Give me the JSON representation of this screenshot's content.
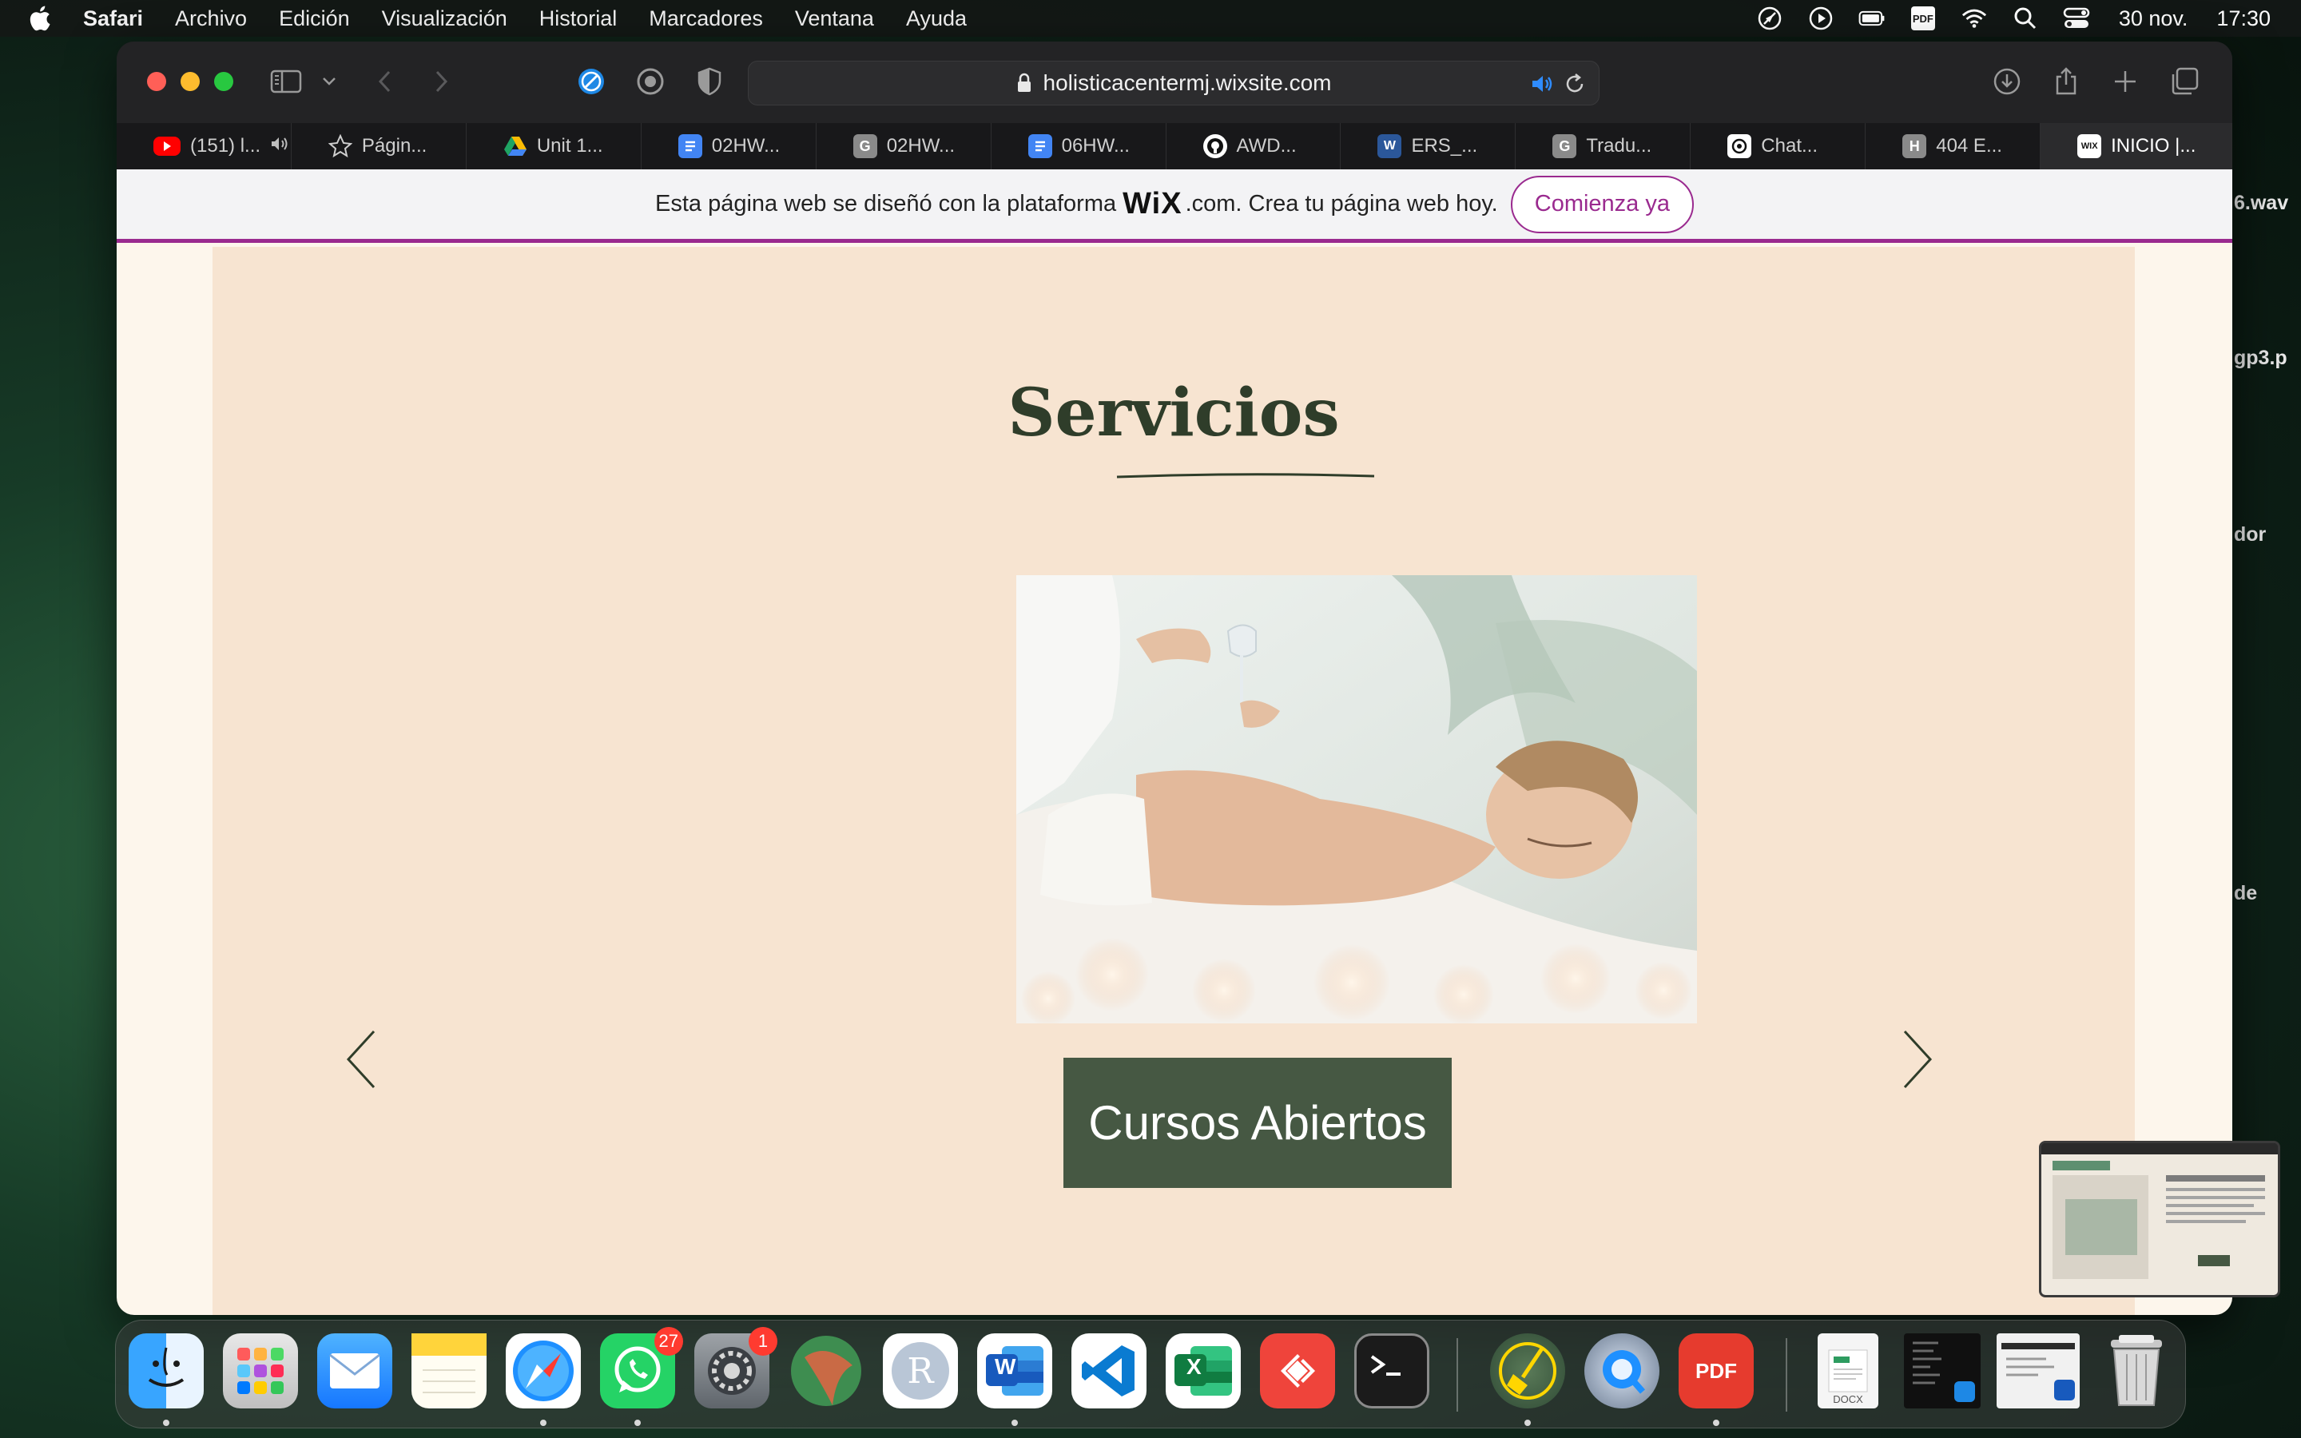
{
  "menubar": {
    "app": "Safari",
    "items": [
      "Archivo",
      "Edición",
      "Visualización",
      "Historial",
      "Marcadores",
      "Ventana",
      "Ayuda"
    ],
    "status_icons": [
      "location-icon",
      "play-icon",
      "battery-icon",
      "pdf-icon",
      "wifi-icon",
      "search-icon",
      "control-center-icon"
    ],
    "pdf_label": "PDF",
    "date": "30 nov.",
    "time": "17:30"
  },
  "browser": {
    "url": "holisticacentermj.wixsite.com",
    "tabs": [
      {
        "label": "(151) l...",
        "icon": "youtube-icon",
        "color": "#ff0000"
      },
      {
        "label": "Págin...",
        "icon": "star-icon",
        "color": "#cfcfcf"
      },
      {
        "label": "Unit 1...",
        "icon": "google-drive-icon",
        "color": "#1fa463"
      },
      {
        "label": "02HW...",
        "icon": "google-docs-icon",
        "color": "#4285f4"
      },
      {
        "label": "02HW...",
        "icon": "grammarly-icon",
        "color": "#8a8a8a"
      },
      {
        "label": "06HW...",
        "icon": "google-docs-icon",
        "color": "#4285f4"
      },
      {
        "label": "AWD...",
        "icon": "github-icon",
        "color": "#ffffff"
      },
      {
        "label": "ERS_...",
        "icon": "word-icon",
        "color": "#2b579a"
      },
      {
        "label": "Tradu...",
        "icon": "grammarly-icon",
        "color": "#8a8a8a"
      },
      {
        "label": "Chat...",
        "icon": "openai-icon",
        "color": "#ffffff"
      },
      {
        "label": "404 E...",
        "icon": "h-icon",
        "color": "#8a8a8a"
      },
      {
        "label": "INICIO |...",
        "icon": "wix-icon",
        "color": "#ffffff",
        "active": true
      }
    ],
    "tab_glyphs": {
      "grammarly": "G",
      "h": "H",
      "wix": "WIX"
    }
  },
  "wixbar": {
    "text_before": "Esta página web se diseñó con la plataforma",
    "logo": "WiX",
    "text_after": ".com. Crea tu página web hoy.",
    "cta": "Comienza ya"
  },
  "section": {
    "title": "Servicios",
    "button": "Cursos Abiertos"
  },
  "desktop_labels": {
    "wav": "6.wav",
    "mp3": "gp3.p",
    "dor": "dor",
    "de": "de"
  },
  "dock": {
    "apps": [
      {
        "name": "finder-icon",
        "badge": null,
        "running": true
      },
      {
        "name": "launchpad-icon",
        "badge": null,
        "running": false
      },
      {
        "name": "mail-icon",
        "badge": null,
        "running": false
      },
      {
        "name": "notes-icon",
        "badge": null,
        "running": false
      },
      {
        "name": "safari-icon",
        "badge": null,
        "running": true
      },
      {
        "name": "whatsapp-icon",
        "badge": "27",
        "running": true
      },
      {
        "name": "system-settings-icon",
        "badge": "1",
        "running": false
      },
      {
        "name": "reaper-icon",
        "badge": null,
        "running": false
      },
      {
        "name": "r-icon",
        "badge": null,
        "running": false
      },
      {
        "name": "word-icon",
        "badge": null,
        "running": true
      },
      {
        "name": "vscode-icon",
        "badge": null,
        "running": false
      },
      {
        "name": "excel-icon",
        "badge": null,
        "running": false
      },
      {
        "name": "anydesk-icon",
        "badge": null,
        "running": false
      },
      {
        "name": "terminal-icon",
        "badge": null,
        "running": false
      },
      {
        "name": "broom-cleaner-icon",
        "badge": null,
        "running": true
      },
      {
        "name": "quicktime-icon",
        "badge": null,
        "running": false
      },
      {
        "name": "pdf-expert-icon",
        "badge": null,
        "running": true
      }
    ],
    "docx_label": "DOCX",
    "r_label": "R",
    "pdf_label": "PDF",
    "word_label": "W",
    "excel_label": "X"
  },
  "colors": {
    "page_bg": "#fdf6ec",
    "panel_bg": "#f7e4d1",
    "title": "#2f3d2a",
    "button_bg": "#465843",
    "wix_accent": "#9a2a8f"
  }
}
